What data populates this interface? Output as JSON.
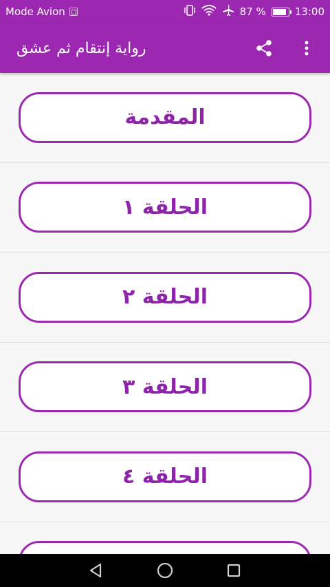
{
  "status_bar": {
    "carrier": "Mode Avion",
    "battery_percent": "87 %",
    "battery_level": 0.87,
    "time": "13:00",
    "icons": [
      "sim-icon",
      "vibrate-icon",
      "wifi-icon",
      "airplane-icon",
      "battery-icon"
    ]
  },
  "app_bar": {
    "title": "رواية إنتقام ثم عشق",
    "actions": [
      "share-icon",
      "more-vert-icon"
    ]
  },
  "chapters": [
    {
      "label": "المقدمة"
    },
    {
      "label": "الحلقة ١"
    },
    {
      "label": "الحلقة ٢"
    },
    {
      "label": "الحلقة ٣"
    },
    {
      "label": "الحلقة ٤"
    },
    {
      "label": ""
    }
  ],
  "nav_bar": {
    "icons": [
      "back-triangle-icon",
      "home-circle-icon",
      "recents-square-icon"
    ]
  },
  "colors": {
    "primary": "#9c27b0",
    "button_text": "#8e24aa",
    "background": "#f7f7f7"
  }
}
